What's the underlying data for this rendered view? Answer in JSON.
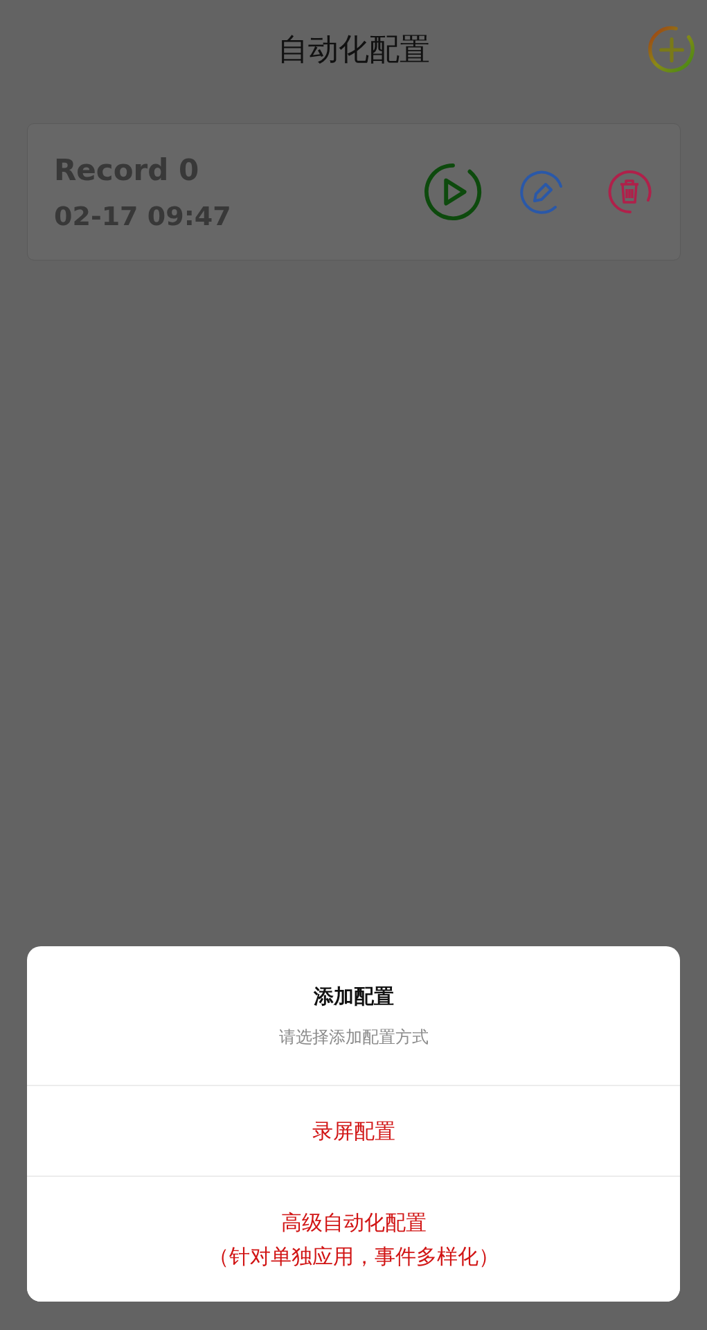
{
  "header": {
    "title": "自动化配置"
  },
  "records": [
    {
      "name": "Record 0",
      "time": "02-17 09:47"
    }
  ],
  "sheet": {
    "title": "添加配置",
    "subtitle": "请选择添加配置方式",
    "options": [
      {
        "lines": [
          "录屏配置"
        ]
      },
      {
        "lines": [
          "高级自动化配置",
          "（针对单独应用，事件多样化）"
        ]
      }
    ]
  }
}
